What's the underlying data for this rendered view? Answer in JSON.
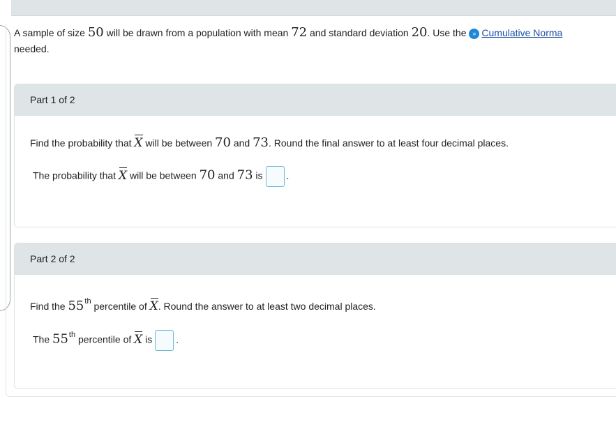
{
  "intro": {
    "text_a": "A sample of size ",
    "sample_size": "50",
    "text_b": " will be drawn from a population with mean ",
    "mean": "72",
    "text_c": " and standard deviation ",
    "sd": "20",
    "text_d": ". Use the ",
    "link_label": "Cumulative Norma",
    "text_e": "needed."
  },
  "part1": {
    "header": "Part 1 of 2",
    "q_a": "Find the probability that ",
    "q_var": "X",
    "q_b": " will be between ",
    "q_low": "70",
    "q_c": " and ",
    "q_high": "73",
    "q_d": ". Round the final answer to at least four decimal places.",
    "a_a": "The probability that ",
    "a_var": "X",
    "a_b": " will be between ",
    "a_low": "70",
    "a_c": " and ",
    "a_high": "73",
    "a_d": " is",
    "a_end": ".",
    "answer_value": ""
  },
  "part2": {
    "header": "Part 2 of 2",
    "q_a": "Find the ",
    "q_num": "55",
    "q_sup": "th",
    "q_b": " percentile of ",
    "q_var": "X",
    "q_c": ". Round the answer to at least two decimal places.",
    "a_a": "The ",
    "a_num": "55",
    "a_sup": "th",
    "a_b": " percentile of ",
    "a_var": "X",
    "a_c": " is",
    "a_end": ".",
    "answer_value": ""
  },
  "colors": {
    "header_bg": "#dfe4e7",
    "link": "#1c4fa8",
    "info_icon": "#1e88d6",
    "answer_border": "#6bb8d8"
  },
  "icons": {
    "info": "chevron-circle-icon"
  }
}
